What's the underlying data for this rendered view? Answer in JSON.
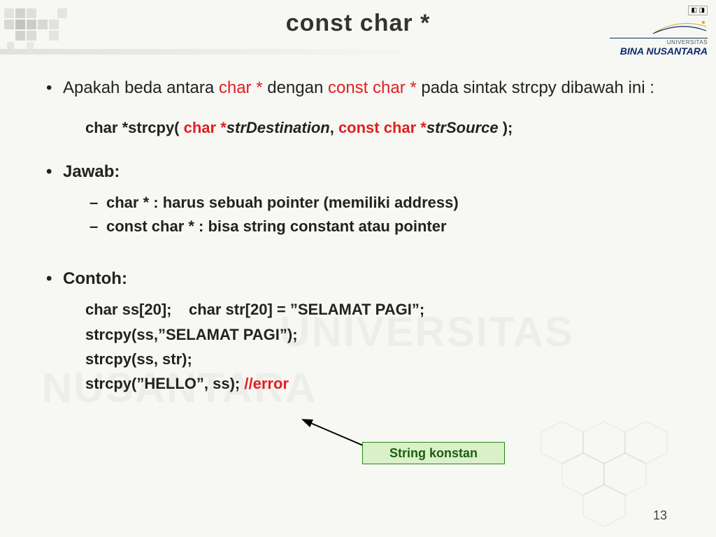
{
  "title": "const char *",
  "brand": {
    "flags_text": "◧ ◨",
    "line1": "UNIVERSITAS",
    "name": "BINA NUSANTARA"
  },
  "watermark1": "UNIVERSITAS",
  "watermark2": "NUSANTARA",
  "bullet1": {
    "p1": "Apakah beda antara ",
    "red1": "char *",
    "p2": " dengan ",
    "red2": "const char *",
    "p3": " pada sintak strcpy dibawah ini :"
  },
  "sig": {
    "p1": "char *strcpy( ",
    "red1": "char *",
    "it1": "strDestination",
    "p2": ", ",
    "red2": "const char *",
    "it2": "strSource",
    "p3": " );"
  },
  "jawab_label": "Jawab:",
  "jawab1": "char * : harus sebuah pointer (memiliki address)",
  "jawab2": "const char * : bisa string constant atau pointer",
  "contoh_label": "Contoh:",
  "contoh1": "char ss[20];    char str[20] = ”SELAMAT PAGI”;",
  "contoh2": "strcpy(ss,”SELAMAT PAGI”);",
  "contoh3": "strcpy(ss, str);",
  "contoh4_a": "strcpy(”HELLO”, ss);  ",
  "contoh4_b": "//error",
  "callout": "String konstan",
  "page_number": "13"
}
